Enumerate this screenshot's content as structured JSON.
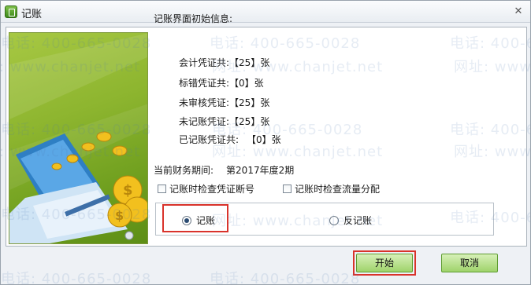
{
  "window": {
    "title": "记账"
  },
  "info": {
    "title": "记账界面初始信息:",
    "rows": [
      {
        "label": "会计凭证共:",
        "value": "【25】张"
      },
      {
        "label": "标错凭证共:",
        "value": "【0】张"
      },
      {
        "label": "未审核凭证:",
        "value": "【25】张"
      },
      {
        "label": "未记账凭证:",
        "value": "【25】张"
      },
      {
        "label": "已记账凭证共:",
        "value": "【0】张"
      }
    ]
  },
  "period": {
    "label": "当前财务期间:",
    "value": "第2017年度2期"
  },
  "checks": {
    "voucher_break": {
      "label": "记账时检查凭证断号",
      "checked": false
    },
    "cashflow_alloc": {
      "label": "记账时检查流量分配",
      "checked": false
    }
  },
  "mode": {
    "post": {
      "label": "记账",
      "selected": true
    },
    "reverse": {
      "label": "反记账",
      "selected": false
    }
  },
  "buttons": {
    "start": "开始",
    "cancel": "取消"
  },
  "watermark": {
    "phone": "电话: 400-665-0028",
    "site": "网址: www.chanjet.net"
  },
  "colors": {
    "accent_green": "#9fd36b",
    "highlight_red": "#d9332b"
  }
}
